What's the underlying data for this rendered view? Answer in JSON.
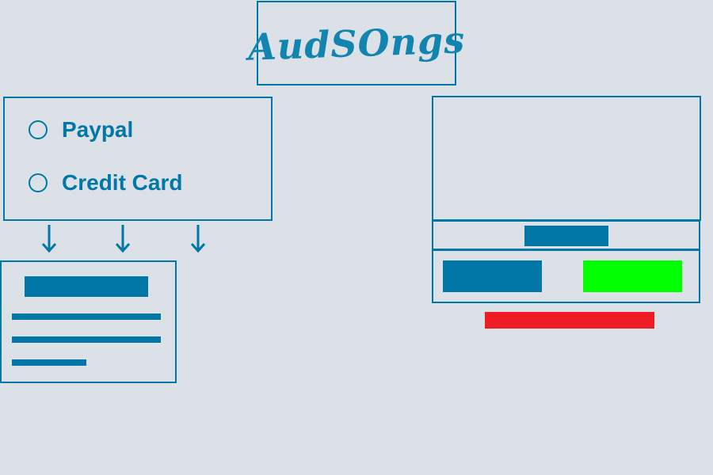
{
  "logo": {
    "text": "AudSOngs"
  },
  "payment": {
    "options": [
      {
        "label": "Paypal",
        "selected": false
      },
      {
        "label": "Credit Card",
        "selected": false
      }
    ]
  },
  "colors": {
    "primary": "#0077a6",
    "background": "#dbe1e7",
    "confirm": "#00ff00",
    "danger": "#ee1c24"
  }
}
